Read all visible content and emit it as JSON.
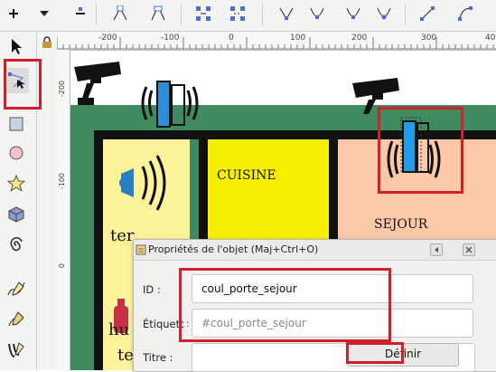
{
  "toolbar": {
    "icons": [
      "plus-icon",
      "dropdown-arrow-icon",
      "minus-icon",
      "node-join-icon",
      "node-break-icon",
      "node-join-segment-icon",
      "node-delete-segment-icon",
      "node-cusp-icon",
      "node-smooth-icon",
      "node-symmetric-icon",
      "node-auto-icon",
      "segment-line-icon",
      "segment-curve-icon"
    ]
  },
  "ruler": {
    "h_labels": [
      "-200",
      "-100",
      "0",
      "100",
      "200",
      "300",
      "400"
    ],
    "v_labels": [
      "-200",
      "-100",
      "0"
    ]
  },
  "canvas": {
    "rooms": {
      "kitchen": "CUISINE",
      "living": "SEJOUR",
      "partial_te": "ter",
      "partial_hu": "hu",
      "partial_te2": "te"
    },
    "colors": {
      "outer_green": "#3f8a5f",
      "kitchen_yellow": "#f5ef00",
      "left_room": "#fcf39b",
      "living_peach": "#fbc9a8",
      "door_blue": "#2a8fd6",
      "selected_door_blue": "#1e9ee8"
    }
  },
  "dialog": {
    "title": "Propriétés de l'objet (Maj+Ctrl+O)",
    "id_label": "ID :",
    "id_value": "coul_porte_sejour",
    "label_label": "Étiquett",
    "label_placeholder": "#coul_porte_sejour",
    "title_label": "Titre :",
    "define_button": "Définir"
  },
  "highlight_color": "#d0202e"
}
